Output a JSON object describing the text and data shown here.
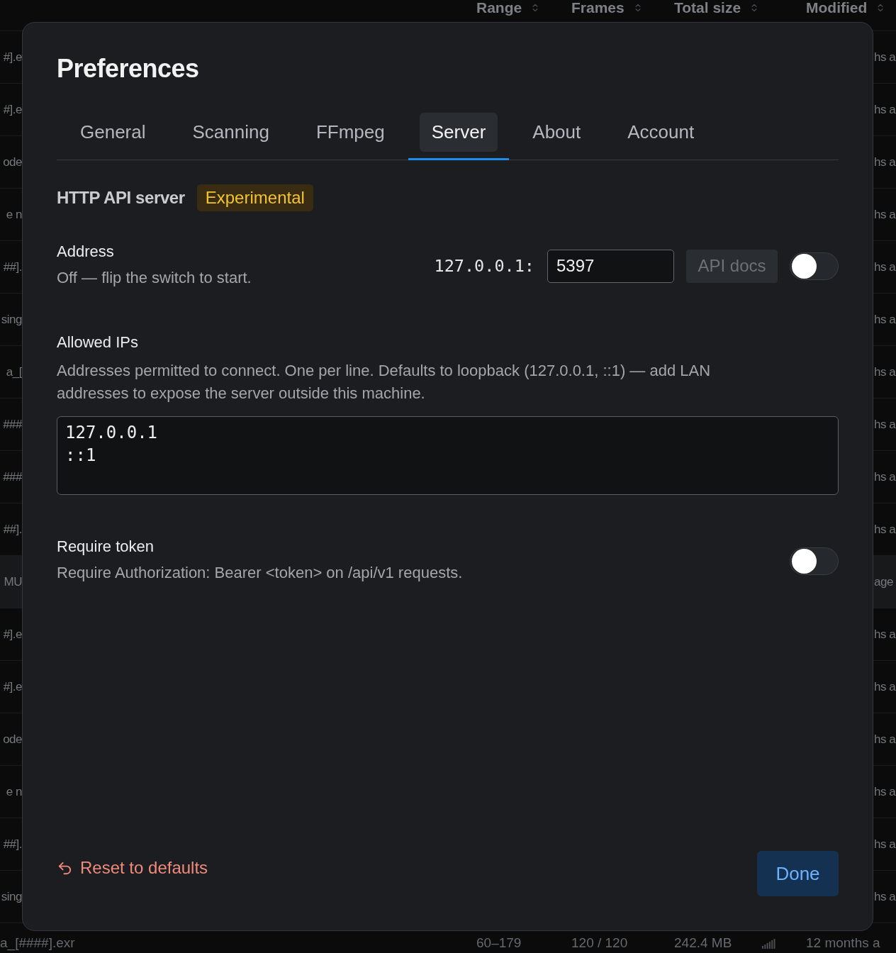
{
  "background_table": {
    "columns": [
      {
        "label": "Range"
      },
      {
        "label": "Frames"
      },
      {
        "label": "Total size"
      },
      {
        "label": "Modified"
      }
    ],
    "rows": [
      {
        "kind": "covered",
        "name": "#].e",
        "modified": "hs a",
        "selected": false
      },
      {
        "kind": "covered",
        "name": "#].e",
        "modified": "hs a",
        "selected": false
      },
      {
        "kind": "covered",
        "name": "ode",
        "modified": "hs a",
        "selected": false
      },
      {
        "kind": "covered",
        "name": "e n",
        "modified": "hs a",
        "selected": false
      },
      {
        "kind": "covered",
        "name": "##].",
        "modified": "hs a",
        "selected": false
      },
      {
        "kind": "covered",
        "name": "sing",
        "modified": "hs a",
        "selected": false
      },
      {
        "kind": "covered",
        "name": "a_[",
        "modified": "hs a",
        "selected": false
      },
      {
        "kind": "covered",
        "name": "###",
        "modified": "hs a",
        "selected": false
      },
      {
        "kind": "covered",
        "name": "###",
        "modified": "hs a",
        "selected": false
      },
      {
        "kind": "covered",
        "name": "##].",
        "modified": "hs a",
        "selected": false
      },
      {
        "kind": "covered",
        "name": "MU",
        "modified": "age",
        "selected": true
      },
      {
        "kind": "covered",
        "name": "#].e",
        "modified": "hs a",
        "selected": false
      },
      {
        "kind": "covered",
        "name": "#].e",
        "modified": "hs a",
        "selected": false
      },
      {
        "kind": "covered",
        "name": "ode",
        "modified": "hs a",
        "selected": false
      },
      {
        "kind": "covered",
        "name": "e n",
        "modified": "hs a",
        "selected": false
      },
      {
        "kind": "covered",
        "name": "##].",
        "modified": "hs a",
        "selected": false
      },
      {
        "kind": "covered",
        "name": "sing",
        "modified": "hs a",
        "selected": false
      },
      {
        "kind": "full",
        "name": "a_[####].exr",
        "range": "60–179",
        "frames": "120 / 120",
        "total_size": "242.4 MB",
        "modified": "12 months a",
        "selected": false
      }
    ]
  },
  "dialog": {
    "title": "Preferences",
    "tabs": [
      {
        "label": "General",
        "selected": false
      },
      {
        "label": "Scanning",
        "selected": false
      },
      {
        "label": "FFmpeg",
        "selected": false
      },
      {
        "label": "Server",
        "selected": true
      },
      {
        "label": "About",
        "selected": false
      },
      {
        "label": "Account",
        "selected": false
      }
    ],
    "section": {
      "title": "HTTP API server",
      "badge": "Experimental"
    },
    "address": {
      "label": "Address",
      "description": "Off — flip the switch to start.",
      "host": "127.0.0.1:",
      "port": "5397",
      "docs_button": {
        "label": "API docs",
        "disabled": true
      },
      "switch_on": false
    },
    "allowed_ips": {
      "label": "Allowed IPs",
      "description": "Addresses permitted to connect. One per line. Defaults to loopback (127.0.0.1, ::1) — add LAN addresses to expose the server outside this machine.",
      "lines": [
        "127.0.0.1",
        "::1"
      ]
    },
    "require_token": {
      "label": "Require token",
      "description": "Require Authorization: Bearer <token> on /api/v1 requests.",
      "switch_on": false
    },
    "reset_link": "Reset to defaults",
    "done_button": "Done"
  }
}
